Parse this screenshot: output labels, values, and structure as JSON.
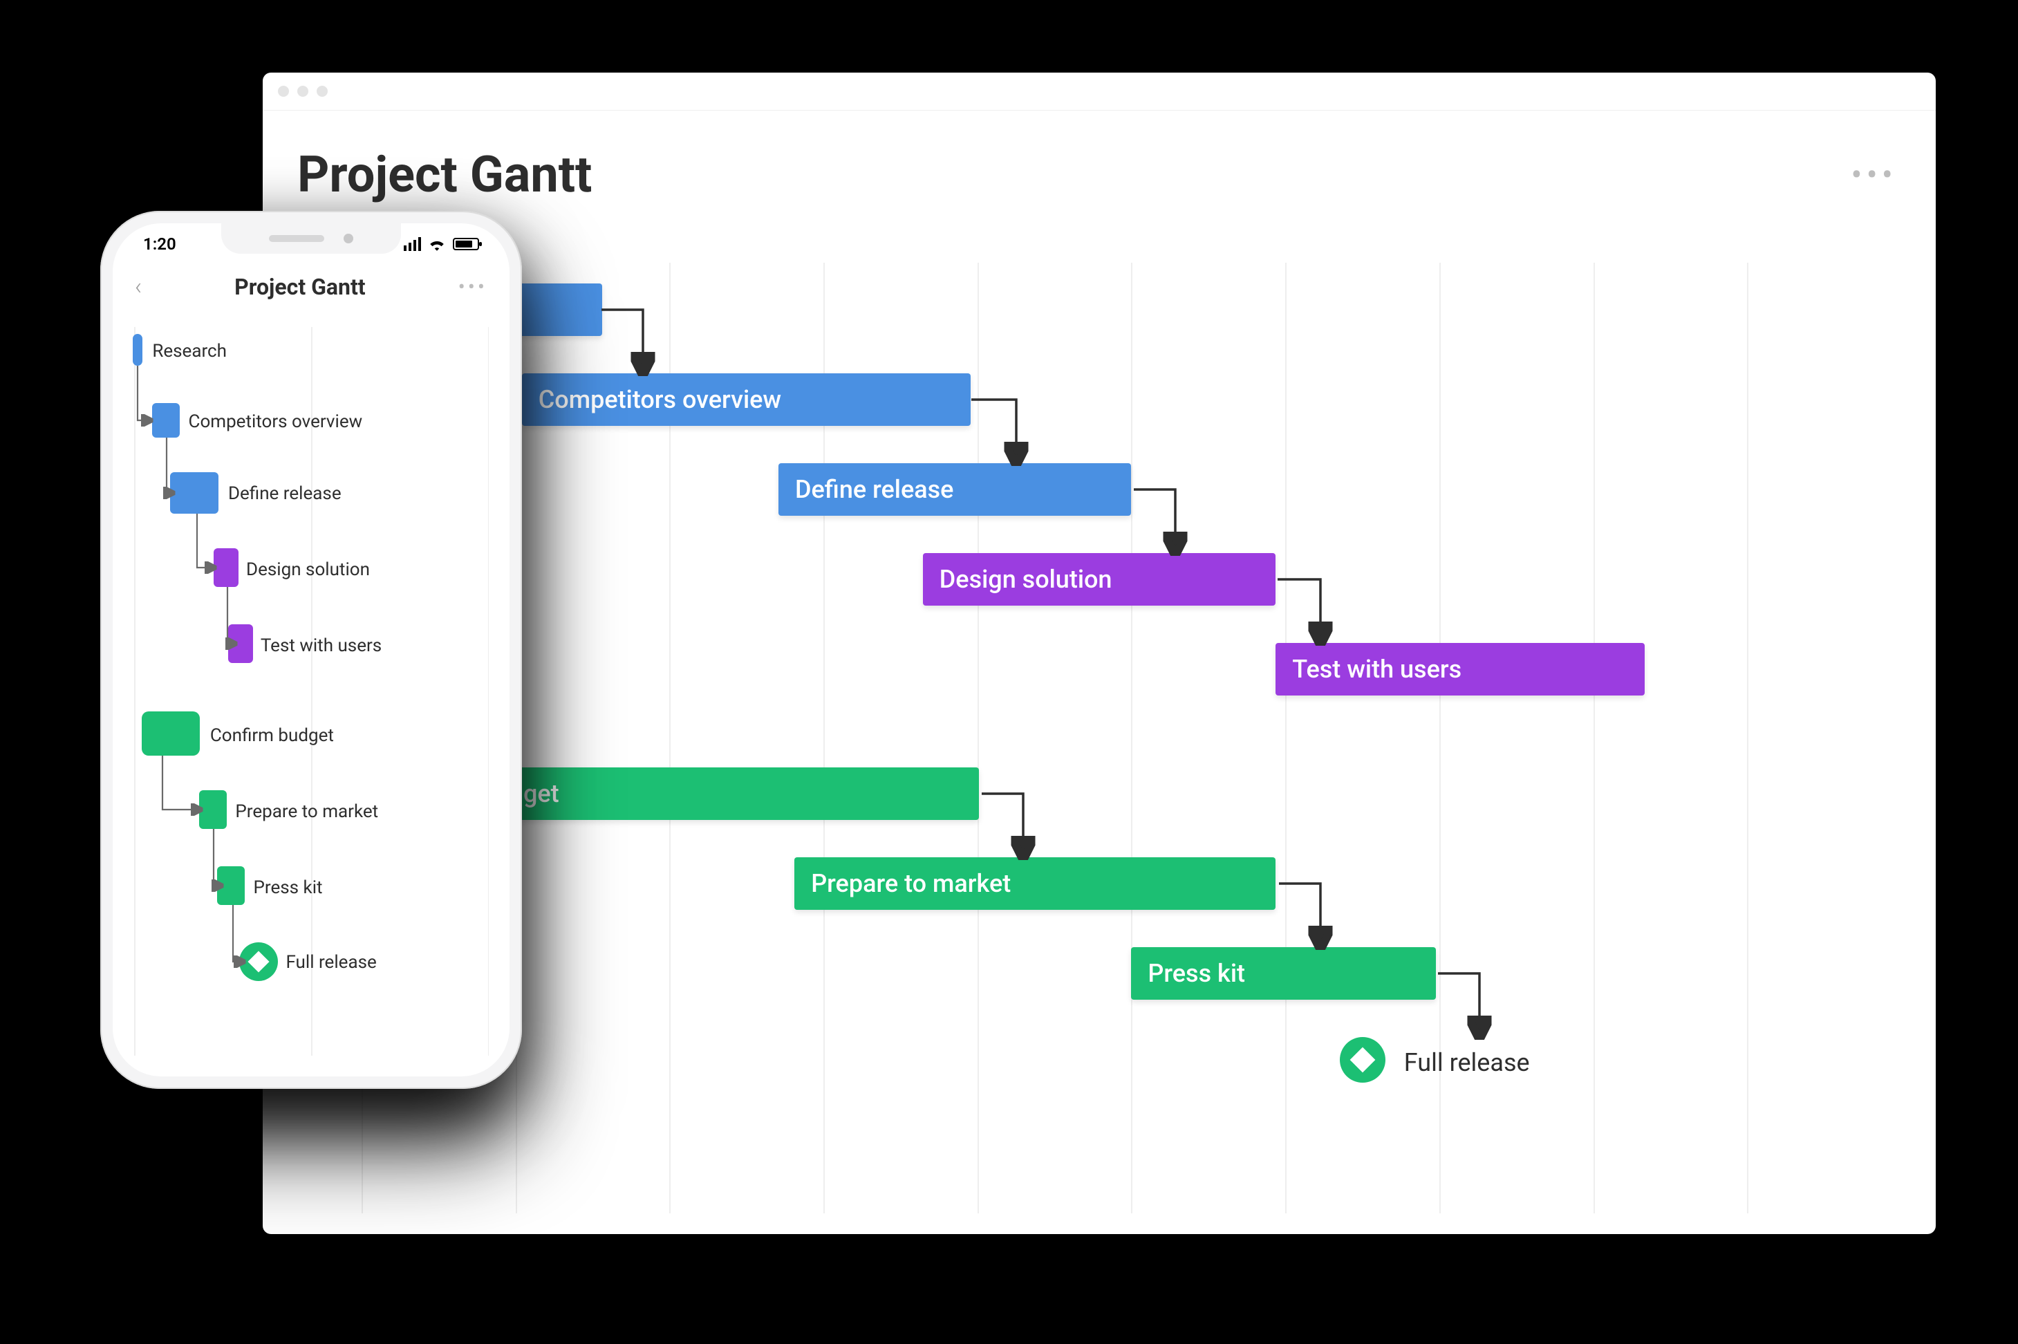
{
  "desktop": {
    "title": "Project Gantt",
    "tasks": [
      {
        "label": "Research",
        "color": "blue"
      },
      {
        "label": "Competitors overview",
        "color": "blue"
      },
      {
        "label": "Define release",
        "color": "blue"
      },
      {
        "label": "Design solution",
        "color": "purple"
      },
      {
        "label": "Test with users",
        "color": "purple"
      },
      {
        "label": "Confirm budget",
        "color": "green"
      },
      {
        "label": "Prepare to market",
        "color": "green"
      },
      {
        "label": "Press kit",
        "color": "green"
      }
    ],
    "milestone": {
      "label": "Full release"
    }
  },
  "phone": {
    "time": "1:20",
    "title": "Project Gantt",
    "tasks": [
      {
        "label": "Research",
        "color": "blue"
      },
      {
        "label": "Competitors overview",
        "color": "blue"
      },
      {
        "label": "Define release",
        "color": "blue"
      },
      {
        "label": "Design solution",
        "color": "purple"
      },
      {
        "label": "Test with users",
        "color": "purple"
      },
      {
        "label": "Confirm budget",
        "color": "green"
      },
      {
        "label": "Prepare to market",
        "color": "green"
      },
      {
        "label": "Press kit",
        "color": "green"
      }
    ],
    "milestone": {
      "label": "Full release"
    }
  },
  "colors": {
    "blue": "#4a90e2",
    "purple": "#9b3de0",
    "green": "#1cbf73"
  },
  "chart_data": {
    "type": "gantt",
    "columns": 10,
    "tasks": [
      {
        "name": "Research",
        "start": 0,
        "end": 1.6,
        "row": 0,
        "color": "blue",
        "depends_on": null
      },
      {
        "name": "Competitors overview",
        "start": 1.1,
        "end": 4.0,
        "row": 1,
        "color": "blue",
        "depends_on": "Research"
      },
      {
        "name": "Define release",
        "start": 2.7,
        "end": 5.0,
        "row": 2,
        "color": "blue",
        "depends_on": "Competitors overview"
      },
      {
        "name": "Design solution",
        "start": 3.7,
        "end": 6.0,
        "row": 3,
        "color": "purple",
        "depends_on": "Define release"
      },
      {
        "name": "Test with users",
        "start": 6.0,
        "end": 8.4,
        "row": 4,
        "color": "purple",
        "depends_on": "Design solution"
      },
      {
        "name": "Confirm budget",
        "start": 0.1,
        "end": 4.0,
        "row": 5,
        "color": "green",
        "depends_on": null
      },
      {
        "name": "Prepare to market",
        "start": 2.9,
        "end": 6.0,
        "row": 6,
        "color": "green",
        "depends_on": "Confirm budget"
      },
      {
        "name": "Press kit",
        "start": 5.0,
        "end": 7.0,
        "row": 7,
        "color": "green",
        "depends_on": "Prepare to market"
      }
    ],
    "milestones": [
      {
        "name": "Full release",
        "at": 6.4,
        "row": 8,
        "depends_on": "Press kit"
      }
    ]
  }
}
